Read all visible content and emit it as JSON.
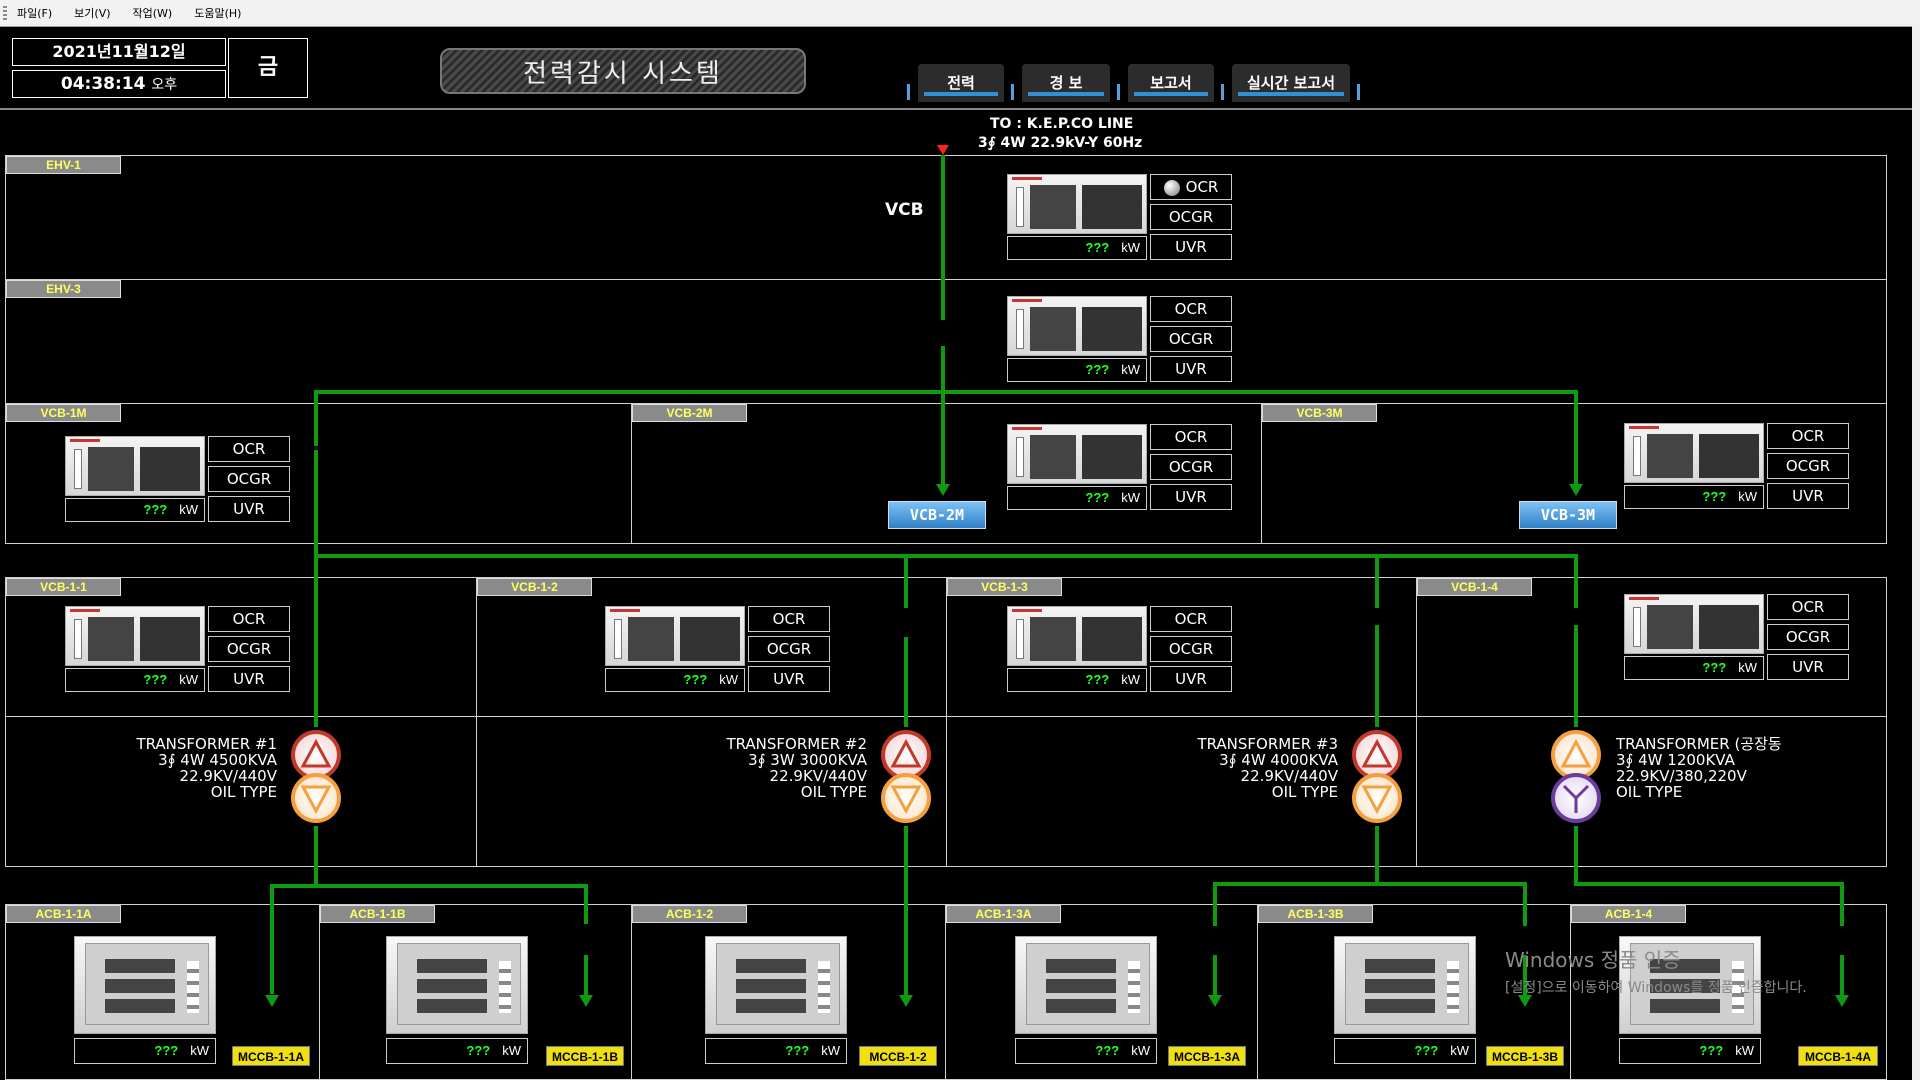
{
  "menu": [
    "파일(F)",
    "보기(V)",
    "작업(W)",
    "도움말(H)"
  ],
  "date": "2021년11월12일",
  "time": "04:38:14",
  "ampm": "오후",
  "weekday": "금",
  "title": "전력감시 시스템",
  "tabs": [
    "전력",
    "경  보",
    "보고서",
    "실시간 보고서"
  ],
  "source": {
    "line1": "TO : K.E.P.CO LINE",
    "line2": "3∮ 4W 22.9kV-Y 60Hz"
  },
  "vcb_label": "VCB",
  "kw_value": "???",
  "kw_unit": "kW",
  "relay_buttons": [
    "OCR",
    "OCGR",
    "UVR"
  ],
  "panels": {
    "ehv1": "EHV-1",
    "ehv3": "EHV-3",
    "vcb1m": "VCB-1M",
    "vcb2m": "VCB-2M",
    "vcb3m": "VCB-3M",
    "vcb11": "VCB-1-1",
    "vcb12": "VCB-1-2",
    "vcb13": "VCB-1-3",
    "vcb14": "VCB-1-4",
    "acb11a": "ACB-1-1A",
    "acb11b": "ACB-1-1B",
    "acb12": "ACB-1-2",
    "acb13a": "ACB-1-3A",
    "acb13b": "ACB-1-3B",
    "acb14": "ACB-1-4"
  },
  "blue_buttons": [
    "VCB-2M",
    "VCB-3M"
  ],
  "mccb": [
    "MCCB-1-1A",
    "MCCB-1-1B",
    "MCCB-1-2",
    "MCCB-1-3A",
    "MCCB-1-3B",
    "MCCB-1-4A"
  ],
  "transformers": [
    {
      "name": "TRANSFORMER #1",
      "spec": "3∮ 4W 4500KVA",
      "volt": "22.9KV/440V",
      "type": "OIL TYPE"
    },
    {
      "name": "TRANSFORMER #2",
      "spec": "3∮ 3W 3000KVA",
      "volt": "22.9KV/440V",
      "type": "OIL TYPE"
    },
    {
      "name": "TRANSFORMER #3",
      "spec": "3∮ 4W 4000KVA",
      "volt": "22.9KV/440V",
      "type": "OIL TYPE"
    },
    {
      "name": "TRANSFORMER (공장동",
      "spec": "3∮ 4W 1200KVA",
      "volt": "22.9KV/380,220V",
      "type": "OIL TYPE"
    }
  ],
  "watermark": {
    "line1": "Windows 정품 인증",
    "line2": "[설정]으로 이동하여 Windows를 정품 인증합니다."
  },
  "colors": {
    "bus": "#119911",
    "label_text": "#ffff60",
    "kw": "#22ff22",
    "mccb": "#f0e010",
    "delta": "#c0392b",
    "wye_primary": "#f5a040",
    "wye": "#6a3d9a"
  }
}
